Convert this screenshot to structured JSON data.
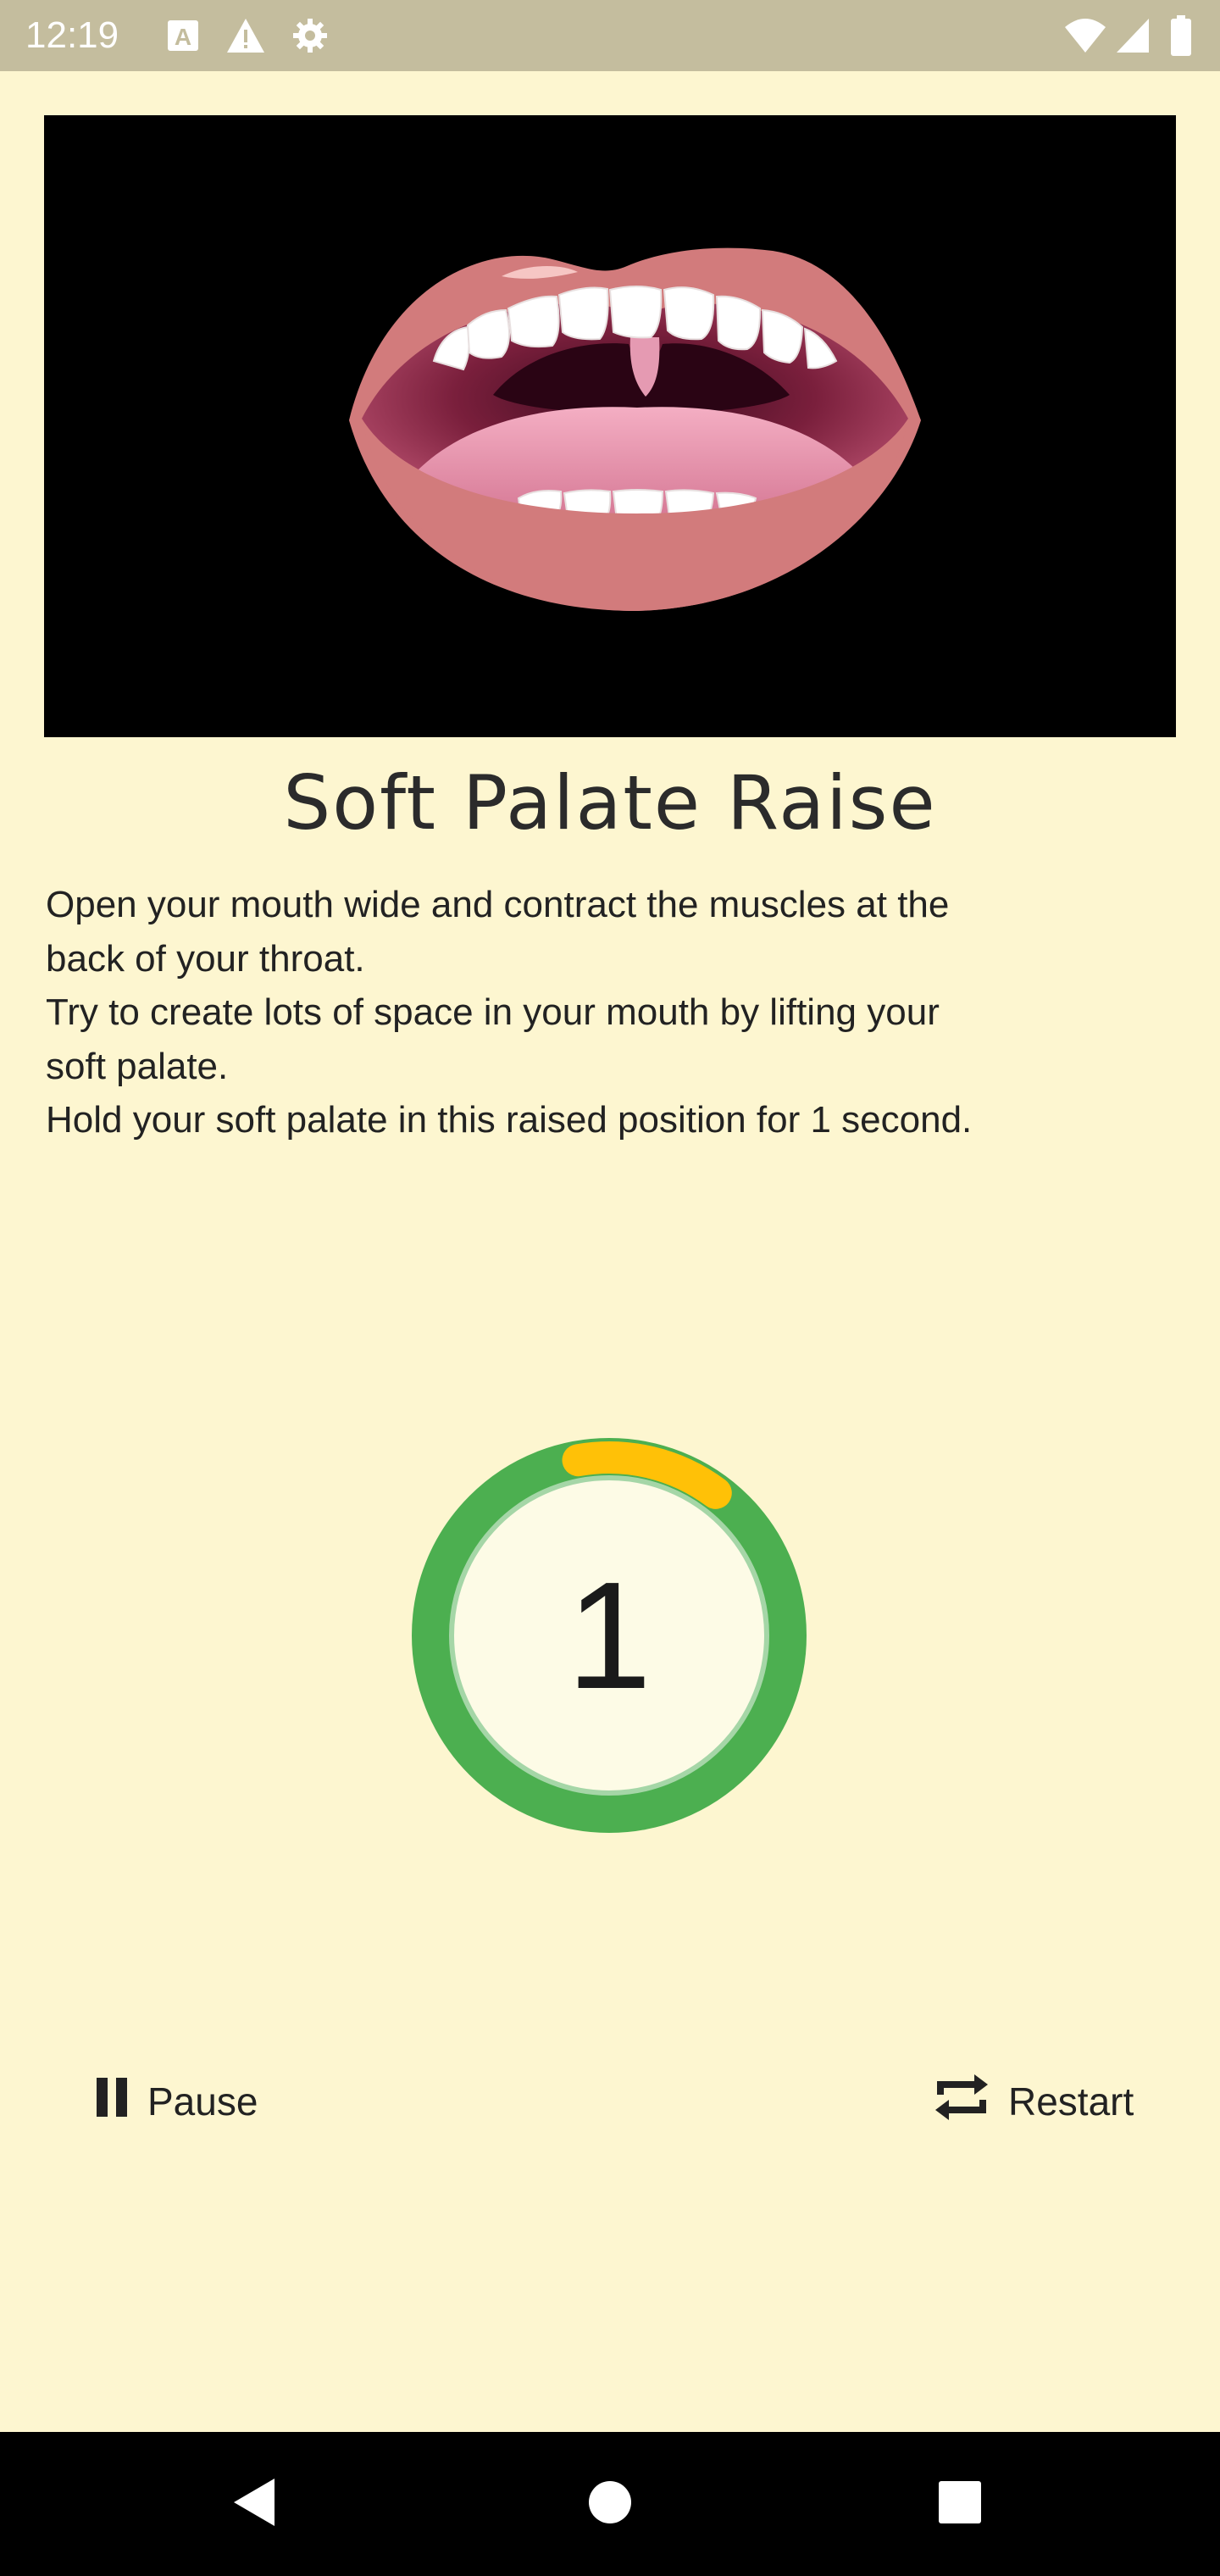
{
  "status_bar": {
    "time": "12:19",
    "icons_left": [
      "text-a-icon",
      "warning-icon",
      "gear-icon"
    ],
    "icons_right": [
      "wifi-icon",
      "signal-icon",
      "battery-icon"
    ]
  },
  "media": {
    "icon": "mouth-illustration"
  },
  "exercise": {
    "title": "Soft Palate Raise",
    "instruction_lines": [
      "Open your mouth wide and contract the muscles at the",
      "back of your throat.",
      "Try to create lots of space in your mouth by lifting your",
      "soft palate.",
      "Hold your soft palate in this raised position for 1 second."
    ]
  },
  "timer": {
    "count": "1",
    "progress": 0.13,
    "colors": {
      "ring": "#4CAF50",
      "progress": "#FFC107",
      "inner": "#FDFBE6"
    }
  },
  "controls": {
    "pause_label": "Pause",
    "pause_icon": "pause-icon",
    "restart_label": "Restart",
    "restart_icon": "repeat-icon"
  },
  "nav_bar": {
    "icons": [
      "back-icon",
      "home-icon",
      "recents-icon"
    ]
  },
  "colors": {
    "background": "#FDF6D0",
    "status_bar": "#C4BD9E"
  }
}
